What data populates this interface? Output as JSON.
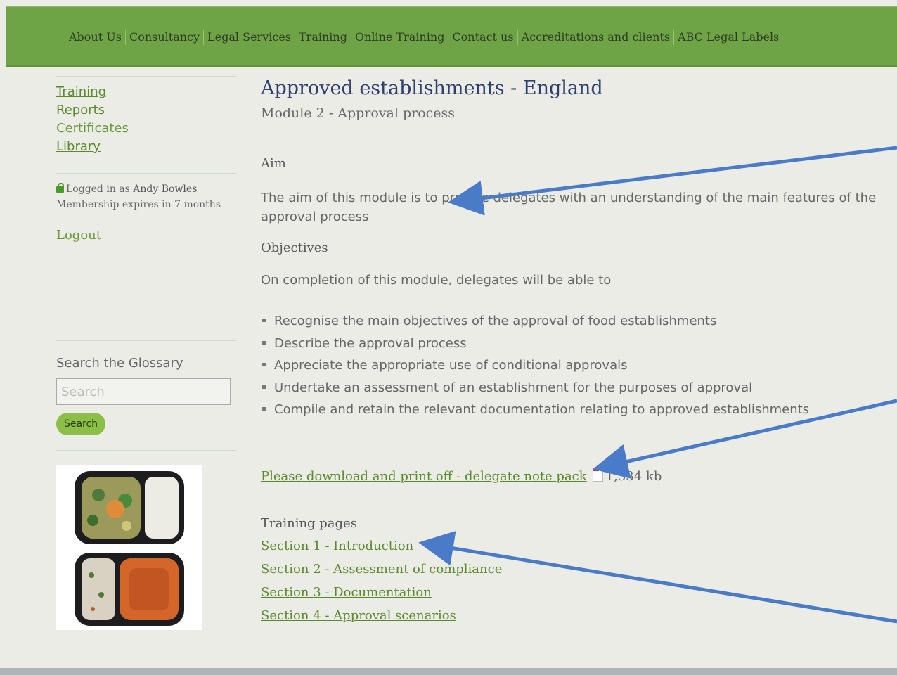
{
  "nav": {
    "items": [
      "About Us",
      "Consultancy",
      "Legal Services",
      "Training",
      "Online Training",
      "Contact us",
      "Accreditations and clients",
      "ABC Legal Labels"
    ]
  },
  "sidebar": {
    "menu": {
      "training": "Training",
      "reports": "Reports",
      "certificates": "Certificates",
      "library": "Library"
    },
    "login": {
      "prefix": "Logged in as",
      "user": "Andy Bowles",
      "membership": "Membership expires in 7 months"
    },
    "logout": "Logout",
    "glossary": {
      "label": "Search the Glossary",
      "placeholder": "Search",
      "button": "Search"
    }
  },
  "main": {
    "title": "Approved establishments - England",
    "subtitle": "Module 2 - Approval process",
    "aim_heading": "Aim",
    "aim_text": "The aim of this module is to provide delegates with an understanding of the main features of the approval process",
    "objectives_heading": "Objectives",
    "objectives_intro": "On completion of this module, delegates will be able to",
    "objectives": [
      "Recognise the main objectives of the approval of food establishments",
      "Describe the approval process",
      "Appreciate the appropriate use of conditional approvals",
      "Undertake an assessment of an establishment for the purposes of approval",
      "Compile and retain the relevant documentation relating to approved establishments"
    ],
    "download": {
      "label": "Please download and print off - delegate note pack",
      "size": "1,334 kb"
    },
    "training_heading": "Training pages",
    "sections": [
      "Section 1 - Introduction",
      "Section 2 - Assessment of compliance",
      "Section 3 - Documentation",
      "Section 4 - Approval scenarios"
    ]
  },
  "colors": {
    "nav_green": "#6ea446",
    "link_green": "#5b8a2e",
    "title_blue": "#2f3f6e",
    "arrow_blue": "#4a7bc8",
    "button_green": "#8bbf46"
  }
}
